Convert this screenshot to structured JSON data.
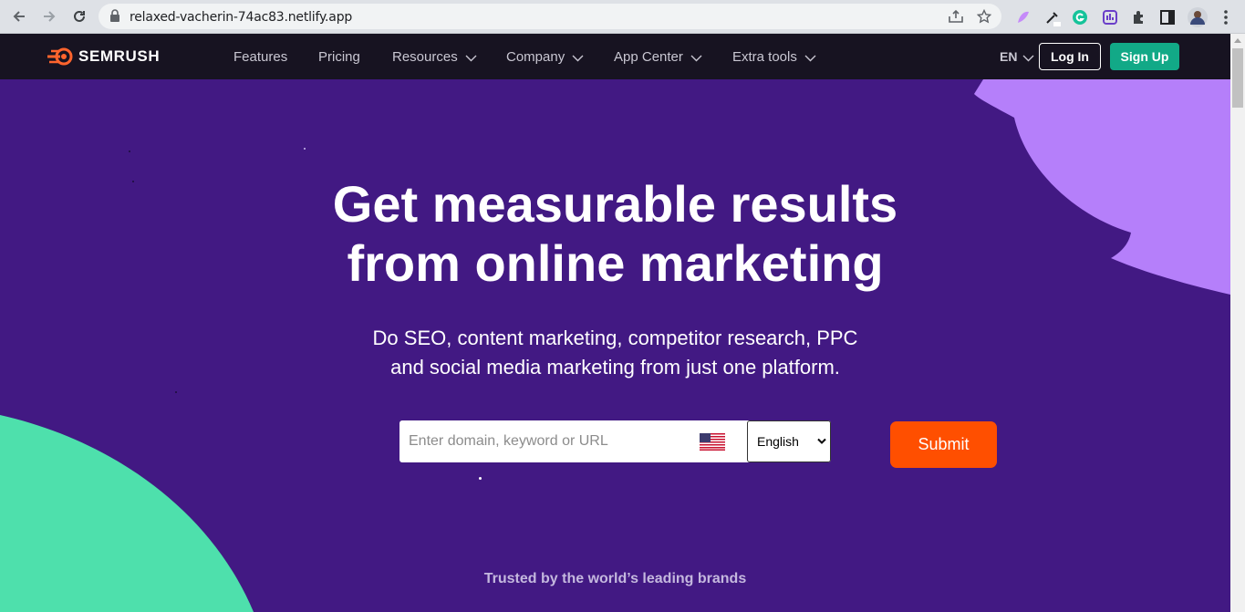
{
  "browser": {
    "url": "relaxed-vacherin-74ac83.netlify.app"
  },
  "site": {
    "logo_text": "SEMRUSH",
    "nav": [
      {
        "label": "Features",
        "has_dropdown": false
      },
      {
        "label": "Pricing",
        "has_dropdown": false
      },
      {
        "label": "Resources",
        "has_dropdown": true
      },
      {
        "label": "Company",
        "has_dropdown": true
      },
      {
        "label": "App Center",
        "has_dropdown": true
      },
      {
        "label": "Extra tools",
        "has_dropdown": true
      }
    ],
    "language": "EN",
    "login_label": "Log In",
    "signup_label": "Sign Up"
  },
  "hero": {
    "title_line1": "Get measurable results",
    "title_line2": "from online marketing",
    "subtitle_line1": "Do SEO, content marketing, competitor research, PPC",
    "subtitle_line2": "and social media marketing from just one platform.",
    "search_placeholder": "Enter domain, keyword or URL",
    "language_option": "English",
    "submit_label": "Submit",
    "trusted_text": "Trusted by the world’s leading brands"
  },
  "colors": {
    "hero_bg": "#421983",
    "nav_bg": "#171321",
    "signup": "#12a987",
    "submit": "#ff4f00",
    "blob_green": "#4ee0ac",
    "blob_purple": "#b57ffa"
  }
}
